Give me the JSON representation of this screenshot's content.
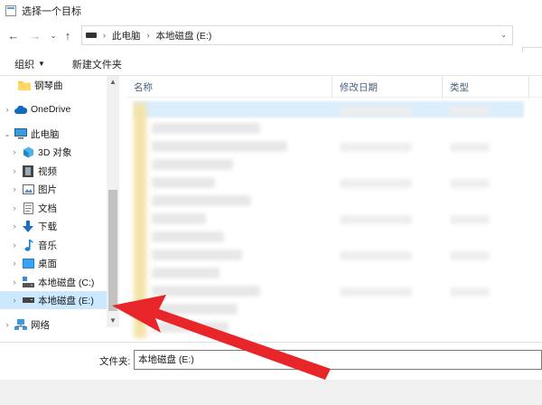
{
  "window": {
    "title": "选择一个目标"
  },
  "address": {
    "crumbs": [
      "此电脑",
      "本地磁盘 (E:)"
    ]
  },
  "toolbar": {
    "organize_label": "组织",
    "new_folder_label": "新建文件夹"
  },
  "nav": {
    "items": [
      {
        "label": "钢琴曲",
        "icon": "folder-icon",
        "expandable": false
      },
      {
        "label": "OneDrive",
        "icon": "cloud-icon",
        "expandable": true
      },
      {
        "label": "此电脑",
        "icon": "computer-icon",
        "expandable": true,
        "expanded": true
      },
      {
        "label": "3D 对象",
        "icon": "cube-icon",
        "expandable": true
      },
      {
        "label": "视频",
        "icon": "video-icon",
        "expandable": true
      },
      {
        "label": "图片",
        "icon": "picture-icon",
        "expandable": true
      },
      {
        "label": "文档",
        "icon": "document-icon",
        "expandable": true
      },
      {
        "label": "下载",
        "icon": "download-icon",
        "expandable": true
      },
      {
        "label": "音乐",
        "icon": "music-icon",
        "expandable": true
      },
      {
        "label": "桌面",
        "icon": "desktop-icon",
        "expandable": true
      },
      {
        "label": "本地磁盘 (C:)",
        "icon": "drive-c-icon",
        "expandable": true
      },
      {
        "label": "本地磁盘 (E:)",
        "icon": "drive-icon",
        "expandable": true,
        "selected": true
      },
      {
        "label": "网络",
        "icon": "network-icon",
        "expandable": true
      }
    ]
  },
  "columns": {
    "name": "名称",
    "modified": "修改日期",
    "type": "类型"
  },
  "folder_field": {
    "label": "文件夹:",
    "value": "本地磁盘 (E:)"
  },
  "colors": {
    "selection": "#cce8ff",
    "arrow": "#e8262a"
  }
}
